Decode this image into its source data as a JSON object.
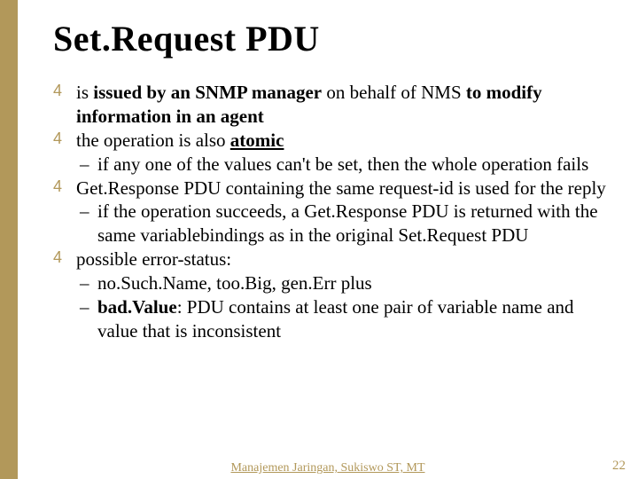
{
  "title": "Set.Request PDU",
  "bullets": {
    "b1a": "is ",
    "b1b": "issued by an SNMP manager",
    "b1c": " on behalf of NMS ",
    "b1d": "to modify information in an agent",
    "b2a": "the operation is also ",
    "b2b": "atomic",
    "b2s1": "if any one of the values can't be set, then the whole operation fails",
    "b3": "Get.Response PDU containing the same request-id is used for the reply",
    "b3s1": "if the operation succeeds, a Get.Response PDU is returned with the same variablebindings as in the original Set.Request PDU",
    "b4": "possible error-status:",
    "b4s1": "no.Such.Name, too.Big, gen.Err plus",
    "b4s2a": "bad.Value",
    "b4s2b": ": PDU contains at least one pair of variable name and value that is inconsistent"
  },
  "footer": "Manajemen Jaringan, Sukiswo ST, MT",
  "page_number": "22"
}
